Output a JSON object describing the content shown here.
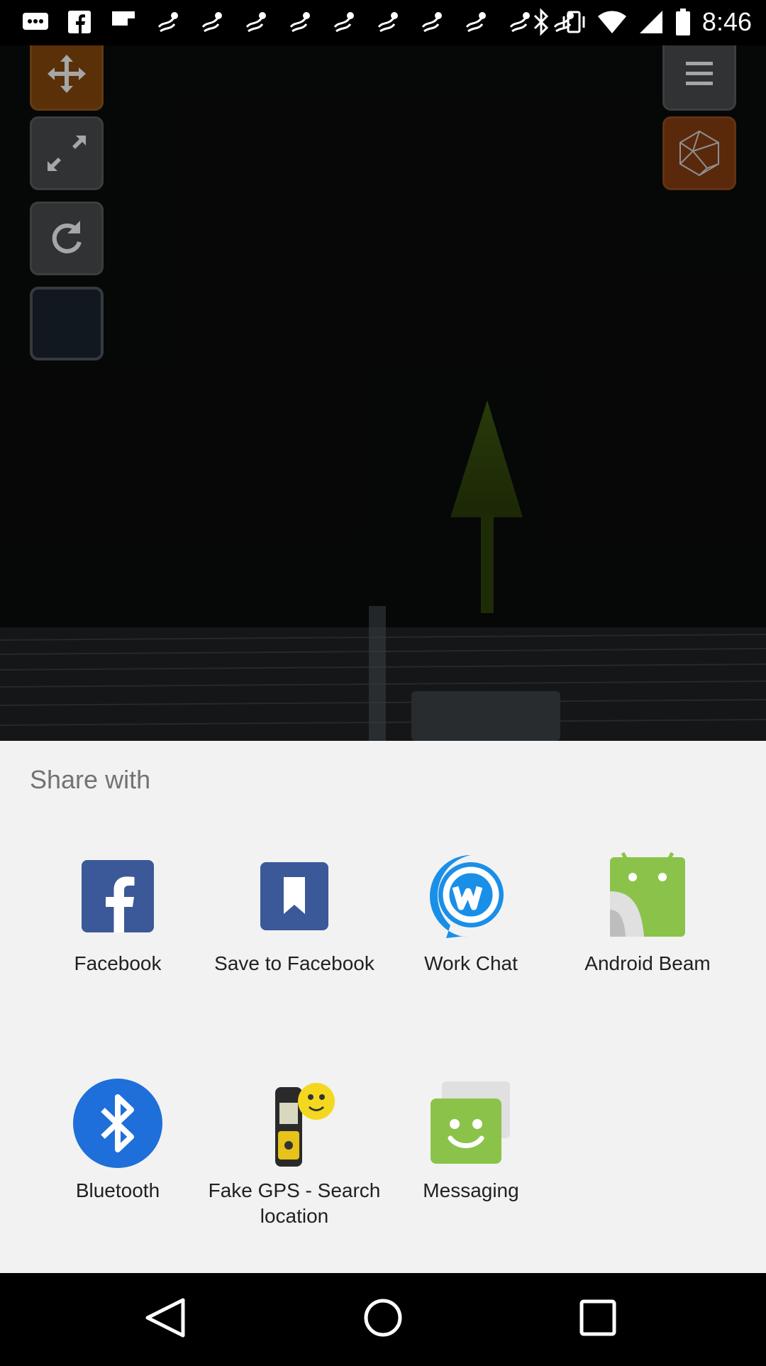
{
  "status_bar": {
    "time": "8:46",
    "notification_icons": [
      "messages-icon",
      "facebook-icon",
      "flipboard-icon",
      "download-icon",
      "download-icon",
      "download-icon",
      "download-icon",
      "download-icon",
      "download-icon",
      "download-icon",
      "download-icon",
      "download-icon"
    ],
    "right_icons": [
      "bluetooth-icon",
      "vibrate-icon",
      "wifi-icon",
      "signal-icon",
      "battery-icon"
    ]
  },
  "scene": {
    "left_toolbar": [
      "move-tool",
      "resize-tool",
      "rotate-tool",
      "shape-tool"
    ],
    "right_toolbar": [
      "menu-button",
      "3d-object-button"
    ]
  },
  "share_sheet": {
    "title": "Share with",
    "apps": [
      {
        "label": "Facebook",
        "icon": "facebook-icon"
      },
      {
        "label": "Save to Facebook",
        "icon": "bookmark-icon"
      },
      {
        "label": "Work Chat",
        "icon": "workchat-icon"
      },
      {
        "label": "Android Beam",
        "icon": "android-icon"
      },
      {
        "label": "Bluetooth",
        "icon": "bluetooth-icon"
      },
      {
        "label": "Fake GPS - Search location",
        "icon": "gps-device-icon"
      },
      {
        "label": "Messaging",
        "icon": "messaging-icon"
      }
    ]
  },
  "navigation": {
    "buttons": [
      "back",
      "home",
      "recents"
    ]
  },
  "colors": {
    "facebook_blue": "#3b5998",
    "workchat_blue": "#1a8fe8",
    "android_green": "#8bc34a",
    "bluetooth_blue": "#1e6fd9",
    "messaging_green": "#8bc34a"
  }
}
